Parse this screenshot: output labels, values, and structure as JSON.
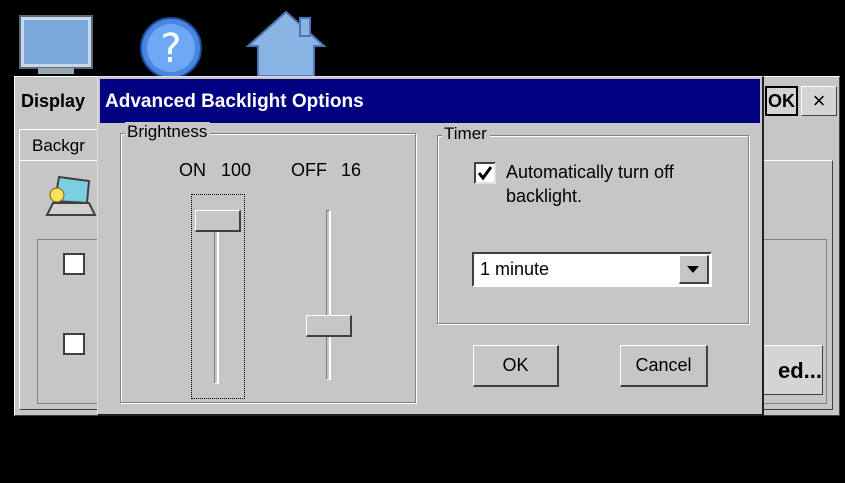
{
  "background_window": {
    "title": "Display",
    "ok_label": "OK",
    "close_label": "×",
    "tab_label": "Backgr",
    "advanced_button_label": "ed..."
  },
  "dialog": {
    "title": "Advanced Backlight Options",
    "brightness": {
      "legend": "Brightness",
      "on_label": "ON",
      "on_value": "100",
      "off_label": "OFF",
      "off_value": "16",
      "on_level": 100,
      "off_level": 16
    },
    "timer": {
      "legend": "Timer",
      "auto_off_label": "Automatically turn off backlight.",
      "auto_off_checked": true,
      "timeout_value": "1 minute"
    },
    "ok_label": "OK",
    "cancel_label": "Cancel"
  },
  "colors": {
    "titlebar": "#000080",
    "face": "#c6c6c6"
  }
}
